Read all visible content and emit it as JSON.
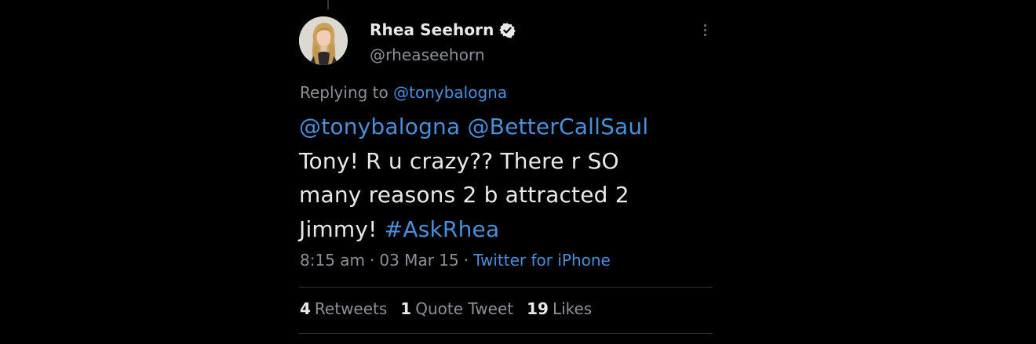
{
  "tweet": {
    "author": {
      "display_name": "Rhea Seehorn",
      "handle": "@rheaseehorn",
      "verified_icon": "verified-badge-icon"
    },
    "replying_prefix": "Replying to",
    "replying_to": "@tonybalogna",
    "text": {
      "mention_1": "@tonybalogna",
      "mention_2": "@BetterCallSaul",
      "line_2": "Tony! R u crazy?? There r SO",
      "line_3": "many reasons 2 b attracted 2",
      "line_4_prefix": "Jimmy!",
      "hashtag": "#AskRhea"
    },
    "time": "8:15 am",
    "date": "03 Mar 15",
    "separator": "·",
    "source": "Twitter for iPhone",
    "stats": {
      "retweets_count": "4",
      "retweets_label": "Retweets",
      "quotes_count": "1",
      "quotes_label": "Quote Tweet",
      "likes_count": "19",
      "likes_label": "Likes"
    }
  },
  "colors": {
    "background": "#000000",
    "text_primary": "#e7e9ea",
    "text_secondary": "#8b9197",
    "link": "#4a8fd9",
    "divider": "#2f3336"
  },
  "icons": {
    "more": "more-options-icon",
    "verified": "verified-badge-icon"
  }
}
